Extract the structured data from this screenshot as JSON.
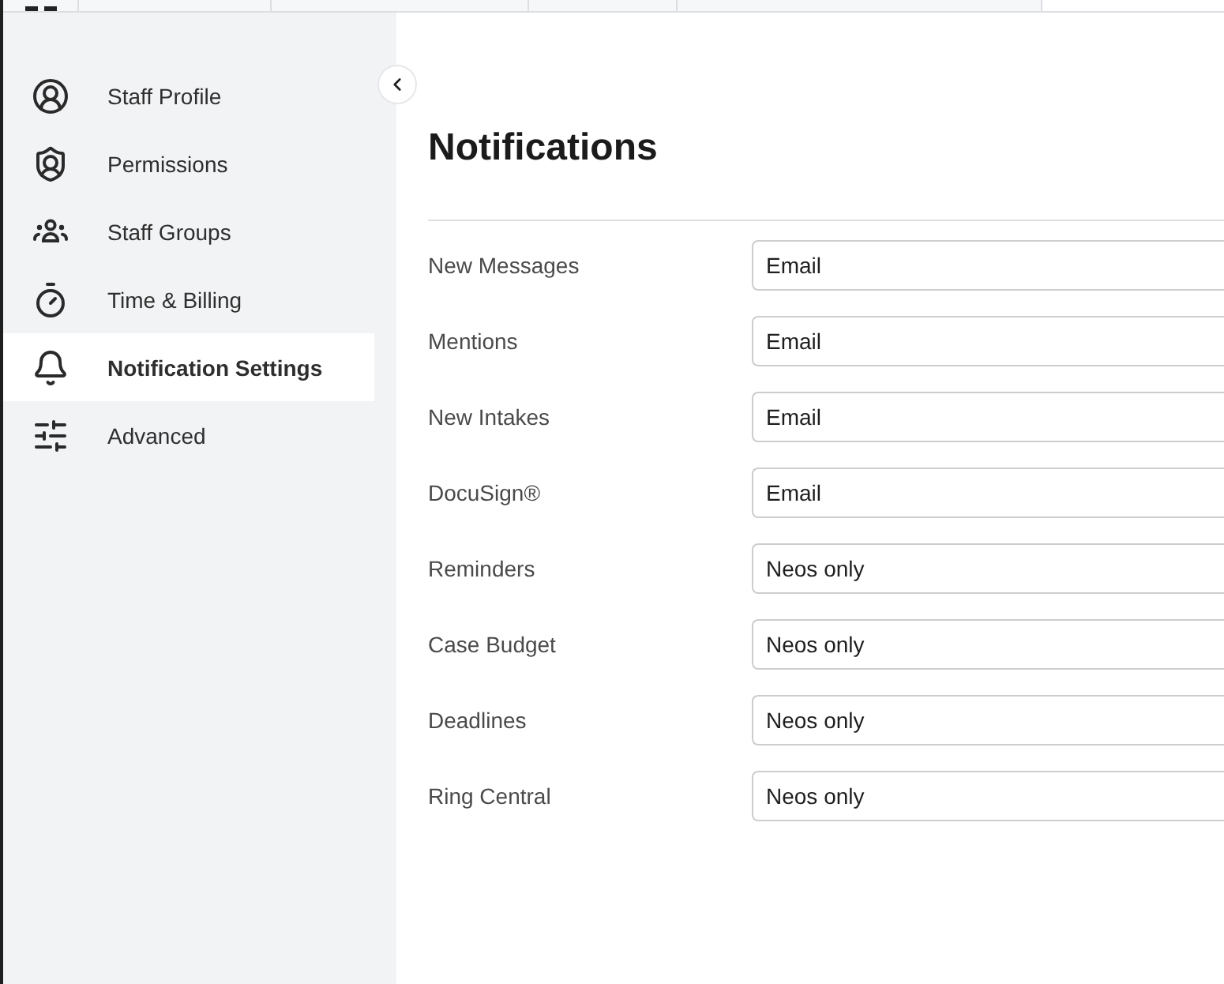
{
  "sidebar": {
    "items": [
      {
        "label": "Staff Profile",
        "selected": false
      },
      {
        "label": "Permissions",
        "selected": false
      },
      {
        "label": "Staff Groups",
        "selected": false
      },
      {
        "label": "Time & Billing",
        "selected": false
      },
      {
        "label": "Notification Settings",
        "selected": true
      },
      {
        "label": "Advanced",
        "selected": false
      }
    ]
  },
  "main": {
    "title": "Notifications",
    "rows": [
      {
        "label": "New Messages",
        "value": "Email"
      },
      {
        "label": "Mentions",
        "value": "Email"
      },
      {
        "label": "New Intakes",
        "value": "Email"
      },
      {
        "label": "DocuSign®",
        "value": "Email"
      },
      {
        "label": "Reminders",
        "value": "Neos only"
      },
      {
        "label": "Case Budget",
        "value": "Neos only"
      },
      {
        "label": "Deadlines",
        "value": "Neos only"
      },
      {
        "label": "Ring Central",
        "value": "Neos only"
      }
    ]
  }
}
